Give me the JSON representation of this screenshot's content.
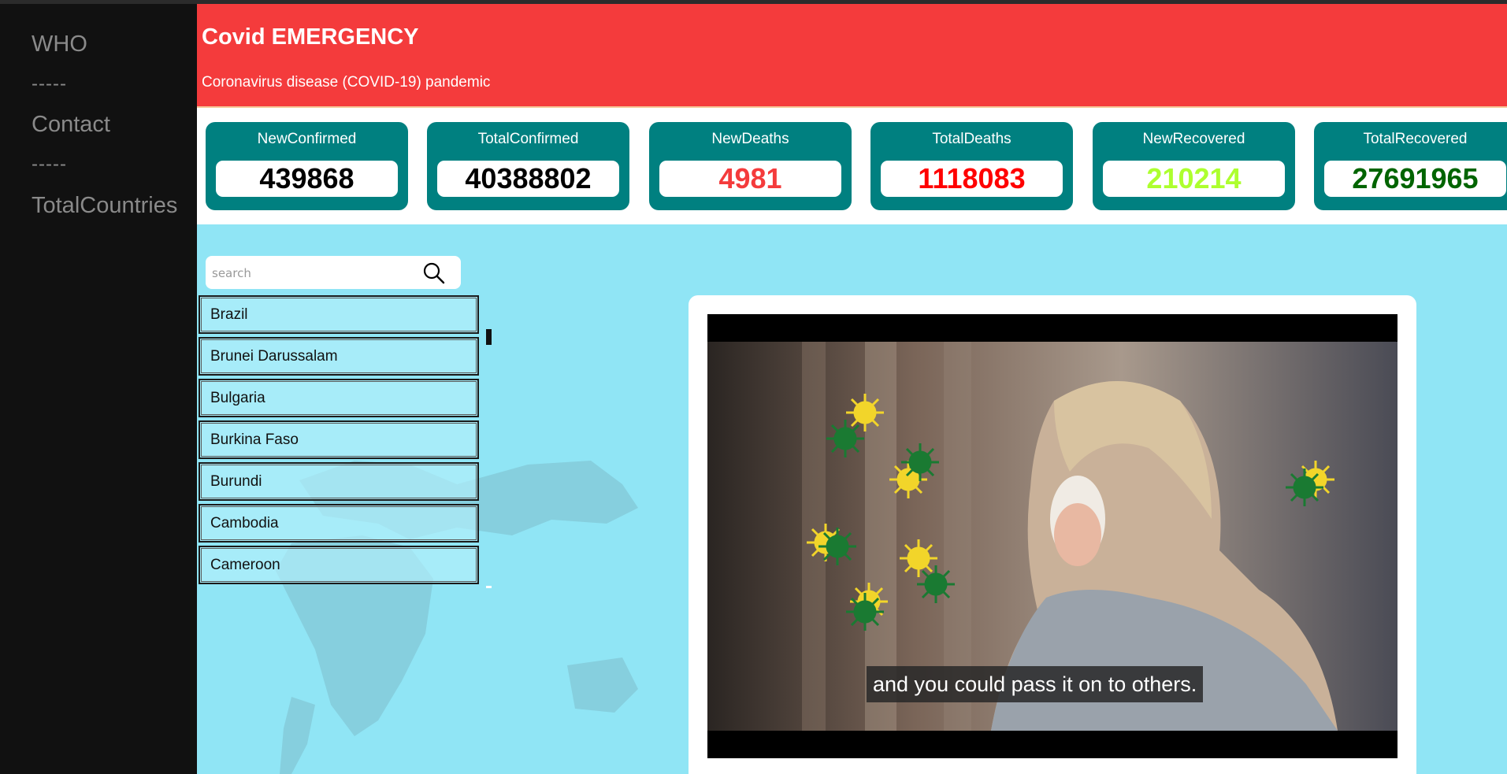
{
  "sidebar": {
    "items": [
      "WHO",
      "Contact",
      "TotalCountries"
    ],
    "separator": "-----"
  },
  "header": {
    "title": "Covid EMERGENCY",
    "subtitle": "Coronavirus disease (COVID-19) pandemic"
  },
  "stats": [
    {
      "label": "NewConfirmed",
      "value": "439868",
      "color": "#000000"
    },
    {
      "label": "TotalConfirmed",
      "value": "40388802",
      "color": "#000000"
    },
    {
      "label": "NewDeaths",
      "value": "4981",
      "color": "#f43b3c"
    },
    {
      "label": "TotalDeaths",
      "value": "1118083",
      "color": "#ff0000"
    },
    {
      "label": "NewRecovered",
      "value": "210214",
      "color": "#adff2f"
    },
    {
      "label": "TotalRecovered",
      "value": "27691965",
      "color": "#006400"
    }
  ],
  "search": {
    "placeholder": "search"
  },
  "countries": [
    "Brazil",
    "Brunei Darussalam",
    "Bulgaria",
    "Burkina Faso",
    "Burundi",
    "Cambodia",
    "Cameroon"
  ],
  "video": {
    "caption": "and you could pass it on to others."
  }
}
